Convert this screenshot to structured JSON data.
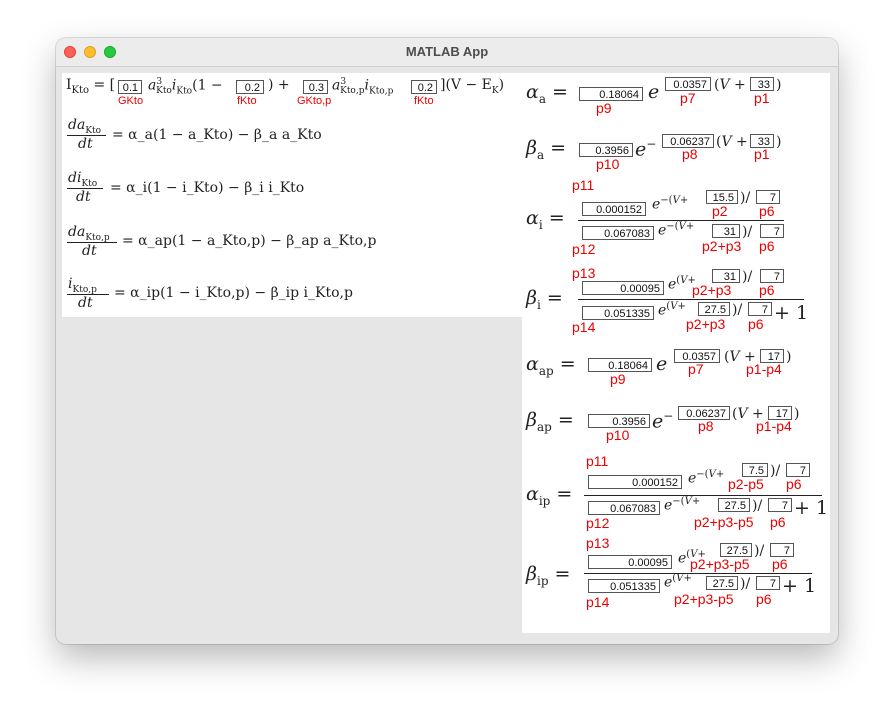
{
  "window": {
    "title": "MATLAB App"
  },
  "ik": {
    "lhs": "I",
    "lhs_sub": "Kto",
    "a": "a",
    "a_sub": "Kto",
    "i": "i",
    "i_sub": "Kto",
    "ap_sub": "Kto,p",
    "ip_sub": "Kto,p",
    "tail": "](V − E",
    "tail_sub": "K",
    "g_kto": "0.1",
    "f_kto": "0.2",
    "g_kto_p": "0.3",
    "f_kto_p": "0.2",
    "labels": [
      "GKto",
      "fKto",
      "GKto,p",
      "fKto"
    ]
  },
  "odes": [
    {
      "num": "da",
      "num_sub": "Kto",
      "rhs": "= α_a(1 − a_Kto) − β_a a_Kto"
    },
    {
      "num": "di",
      "num_sub": "Kto",
      "rhs": "= α_i(1 − i_Kto) − β_i i_Kto"
    },
    {
      "num": "da",
      "num_sub": "Kto,p",
      "rhs": "= α_ap(1 − a_Kto,p) − β_ap a_Kto,p"
    },
    {
      "num": "i",
      "num_sub": "Kto,p",
      "rhs": "= α_ip(1 − i_Kto,p) − β_ip i_Kto,p"
    }
  ],
  "ode_den": "dt",
  "rates": {
    "alpha_a": {
      "name": "α",
      "sub": "a",
      "coef": "0.18064",
      "k": "0.0357",
      "shift": "33",
      "labels": [
        "p9",
        "p7",
        "p1"
      ]
    },
    "beta_a": {
      "name": "β",
      "sub": "a",
      "coef": "0.3956",
      "k": "0.06237",
      "shift": "33",
      "labels": [
        "p10",
        "p8",
        "p1"
      ]
    },
    "alpha_i": {
      "name": "α",
      "sub": "i",
      "num_coef": "0.000152",
      "num_shift": "15.5",
      "num_div": "7",
      "den_coef": "0.067083",
      "den_shift": "31",
      "den_div": "7",
      "labels": [
        "p11",
        "p2",
        "p6",
        "p12",
        "p2+p3",
        "p6"
      ]
    },
    "beta_i": {
      "name": "β",
      "sub": "i",
      "num_coef": "0.00095",
      "num_shift": "31",
      "num_div": "7",
      "den_coef": "0.051335",
      "den_shift": "27.5",
      "den_div": "7",
      "labels": [
        "p13",
        "p2+p3",
        "p6",
        "p14",
        "p2+p3",
        "p6"
      ]
    },
    "alpha_ap": {
      "name": "α",
      "sub": "ap",
      "coef": "0.18064",
      "k": "0.0357",
      "shift": "17",
      "labels": [
        "p9",
        "p7",
        "p1-p4"
      ]
    },
    "beta_ap": {
      "name": "β",
      "sub": "ap",
      "coef": "0.3956",
      "k": "0.06237",
      "shift": "17",
      "labels": [
        "p10",
        "p8",
        "p1-p4"
      ]
    },
    "alpha_ip": {
      "name": "α",
      "sub": "ip",
      "num_coef": "0.000152",
      "num_shift": "7.5",
      "num_div": "7",
      "den_coef": "0.067083",
      "den_shift": "27.5",
      "den_div": "7",
      "labels": [
        "p11",
        "p2-p5",
        "p6",
        "p12",
        "p2+p3-p5",
        "p6"
      ]
    },
    "beta_ip": {
      "name": "β",
      "sub": "ip",
      "num_coef": "0.00095",
      "num_shift": "27.5",
      "num_div": "7",
      "den_coef": "0.051335",
      "den_shift": "27.5",
      "den_div": "7",
      "labels": [
        "p13",
        "p2+p3-p5",
        "p6",
        "p14",
        "p2+p3-p5",
        "p6"
      ]
    }
  },
  "colors": {
    "label": "#ee0000",
    "panel": "#ffffff",
    "background": "#e6e6e6"
  }
}
